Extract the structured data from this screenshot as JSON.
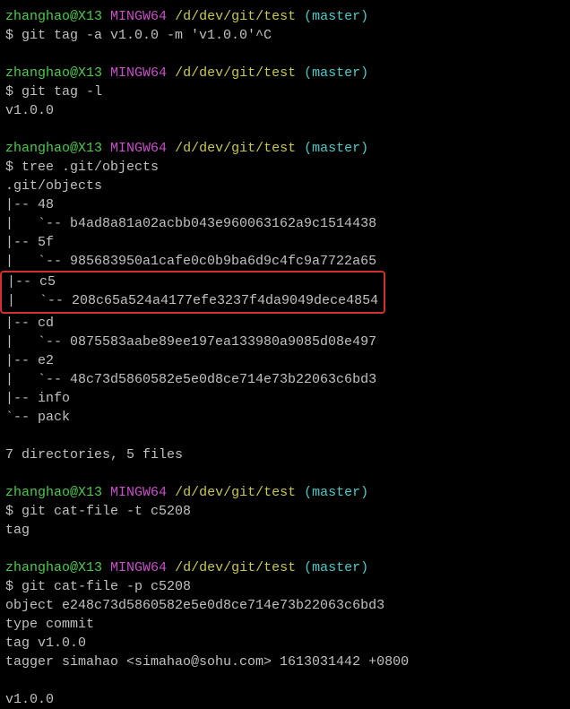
{
  "prompt": {
    "user": "zhanghao@X13",
    "env": "MINGW64",
    "path": "/d/dev/git/test",
    "branch": "(master)",
    "symbol": "$ "
  },
  "cmd1": "git tag -a v1.0.0 -m 'v1.0.0'^C",
  "cmd2": "git tag -l",
  "out2": "v1.0.0",
  "cmd3": "tree .git/objects",
  "tree": {
    "root": ".git/objects",
    "l01": "|-- 48",
    "l02": "|   `-- b4ad8a81a02acbb043e960063162a9c1514438",
    "l03": "|-- 5f",
    "l04": "|   `-- 985683950a1cafe0c0b9ba6d9c4fc9a7722a65",
    "l05a": "|-- ",
    "l05b": "c5",
    "l06a": "|   `-- ",
    "l06b": "208c65a524a4177efe3237f4da9049dece4854",
    "l07": "|-- cd",
    "l08": "|   `-- 0875583aabe89ee197ea133980a9085d08e497",
    "l09": "|-- e2",
    "l10": "|   `-- 48c73d5860582e5e0d8ce714e73b22063c6bd3",
    "l11": "|-- info",
    "l12": "`-- pack",
    "summary": "7 directories, 5 files"
  },
  "cmd4": "git cat-file -t c5208",
  "out4": "tag",
  "cmd5": "git cat-file -p c5208",
  "out5": {
    "l1": "object e248c73d5860582e5e0d8ce714e73b22063c6bd3",
    "l2": "type commit",
    "l3": "tag v1.0.0",
    "l4": "tagger simahao <simahao@sohu.com> 1613031442 +0800",
    "l5": "v1.0.0"
  }
}
